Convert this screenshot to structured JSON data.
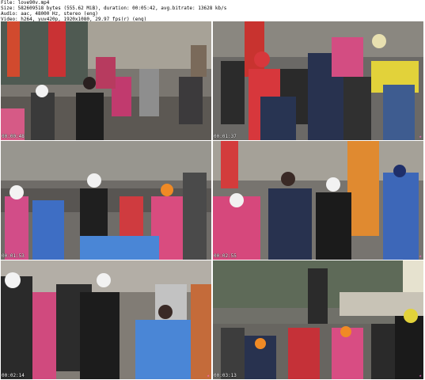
{
  "header": {
    "file_line": "File: love90v.mp4",
    "size_line": "Size: 582609518 bytes (555.62 MiB), duration: 00:05:42, avg.bitrate: 13628 kb/s",
    "audio_line": "Audio: aac, 48000 Hz, stereo (eng)",
    "video_line": "Video: h264, yuv420p, 1920x1080, 29.97 fps(r) (eng)"
  },
  "thumbnails": [
    {
      "timestamp": "00:00:48",
      "scene": "dancers with fox masks on street, shop signs"
    },
    {
      "timestamp": "00:01:37",
      "scene": "crowd dancing, red hooded costume"
    },
    {
      "timestamp": "00:01:53",
      "scene": "girl with fox mask, crowd in street"
    },
    {
      "timestamp": "00:02:55",
      "scene": "man in navy hoodie dancing, girl in black dress"
    },
    {
      "timestamp": "00:02:14",
      "scene": "group dancing, girl in blue kimono"
    },
    {
      "timestamp": "00:03:13",
      "scene": "dancers with orange caps and fox masks"
    },
    {
      "timestamp": "00:03:52",
      "scene": "girl in blue happi coat, black dress dancer"
    },
    {
      "timestamp": "00:04:48",
      "scene": "crowd with orange caps, shop front"
    }
  ],
  "colors": {
    "sky": "#b9c3c8",
    "street": "#6d6a66",
    "shop_red": "#d1383a",
    "hoodie_navy": "#283452",
    "blue_kimono": "#4a86d6",
    "pink": "#e65a8e",
    "orange_cap": "#f08a25",
    "watermark": "#ff66cc"
  }
}
